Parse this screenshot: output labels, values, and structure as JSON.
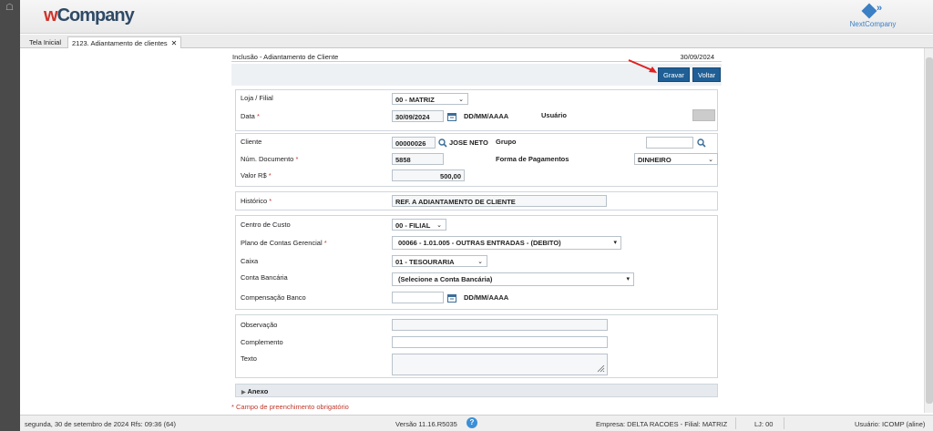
{
  "app": {
    "logo_w": "w",
    "logo_rest": "Company",
    "partner_logo": "NextCompany"
  },
  "tabs": [
    {
      "label": "Tela Inicial"
    },
    {
      "label": "2123. Adiantamento de clientes"
    }
  ],
  "form": {
    "title": "Inclusão - Adiantamento de Cliente",
    "date": "30/09/2024",
    "save_label": "Gravar",
    "back_label": "Voltar",
    "loja_label": "Loja / Filial",
    "loja_value": "00 - MATRIZ",
    "data_label": "Data",
    "data_value": "30/09/2024",
    "date_format": "DD/MM/AAAA",
    "usuario_label": "Usuário",
    "cliente_label": "Cliente",
    "cliente_code": "00000026",
    "cliente_name": "JOSE NETO",
    "grupo_label": "Grupo",
    "numdoc_label": "Núm. Documento",
    "numdoc_value": "5858",
    "forma_label": "Forma de Pagamentos",
    "forma_value": "DINHEIRO",
    "valor_label": "Valor R$",
    "valor_value": "500,00",
    "historico_label": "Histórico",
    "historico_value": "REF. A ADIANTAMENTO DE CLIENTE",
    "centro_label": "Centro de Custo",
    "centro_value": "00 - FILIAL",
    "plano_label": "Plano de Contas Gerencial",
    "plano_value": "00066 - 1.01.005 - OUTRAS ENTRADAS - (DEBITO)",
    "caixa_label": "Caixa",
    "caixa_value": "01 - TESOURARIA",
    "conta_label": "Conta Bancária",
    "conta_value": "(Selecione a Conta Bancária)",
    "comp_label": "Compensação Banco",
    "comp_format": "DD/MM/AAAA",
    "obs_label": "Observação",
    "complemento_label": "Complemento",
    "texto_label": "Texto",
    "anexo_label": "Anexo",
    "required_star": "*",
    "required_note": "* Campo de preenchimento obrigatório"
  },
  "status": {
    "datetime": "segunda, 30 de setembro de 2024  Rfs: 09:36 (64)",
    "version": "Versão 11.16.R5035",
    "company": "Empresa: DELTA RACOES - Filial: MATRIZ",
    "lj": "LJ: 00",
    "user": "Usuário: ICOMP (aline)"
  },
  "colors": {
    "primary_button": "#1f5f96",
    "required": "#c0392b",
    "brand_red": "#d0342c",
    "brand_navy": "#2f4a66"
  }
}
